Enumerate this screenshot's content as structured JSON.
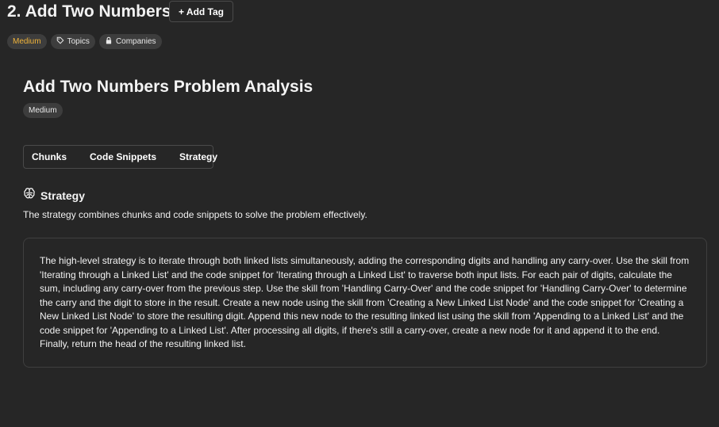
{
  "header": {
    "title": "2. Add Two Numbers",
    "add_tag_label": "+ Add Tag"
  },
  "tags": [
    {
      "label": "Medium",
      "color": "#f1b43a"
    },
    {
      "label": "Topics",
      "icon": "tag-icon"
    },
    {
      "label": "Companies",
      "icon": "lock-icon"
    }
  ],
  "analysis": {
    "title": "Add Two Numbers Problem Analysis",
    "difficulty": "Medium",
    "tabs": [
      "Chunks",
      "Code Snippets",
      "Strategy"
    ]
  },
  "strategy": {
    "icon": "brain-icon",
    "title": "Strategy",
    "description": "The strategy combines chunks and code snippets to solve the problem effectively.",
    "body": "The high-level strategy is to iterate through both linked lists simultaneously, adding the corresponding digits and handling any carry-over. Use the skill from 'Iterating through a Linked List' and the code snippet for 'Iterating through a Linked List' to traverse both input lists. For each pair of digits, calculate the sum, including any carry-over from the previous step. Use the skill from 'Handling Carry-Over' and the code snippet for 'Handling Carry-Over' to determine the carry and the digit to store in the result. Create a new node using the skill from 'Creating a New Linked List Node' and the code snippet for 'Creating a New Linked List Node' to store the resulting digit. Append this new node to the resulting linked list using the skill from 'Appending to a Linked List' and the code snippet for 'Appending to a Linked List'. After processing all digits, if there's still a carry-over, create a new node for it and append it to the end. Finally, return the head of the resulting linked list."
  },
  "colors": {
    "background": "#262626",
    "chip": "#3d3d3d",
    "medium": "#f1b43a"
  }
}
